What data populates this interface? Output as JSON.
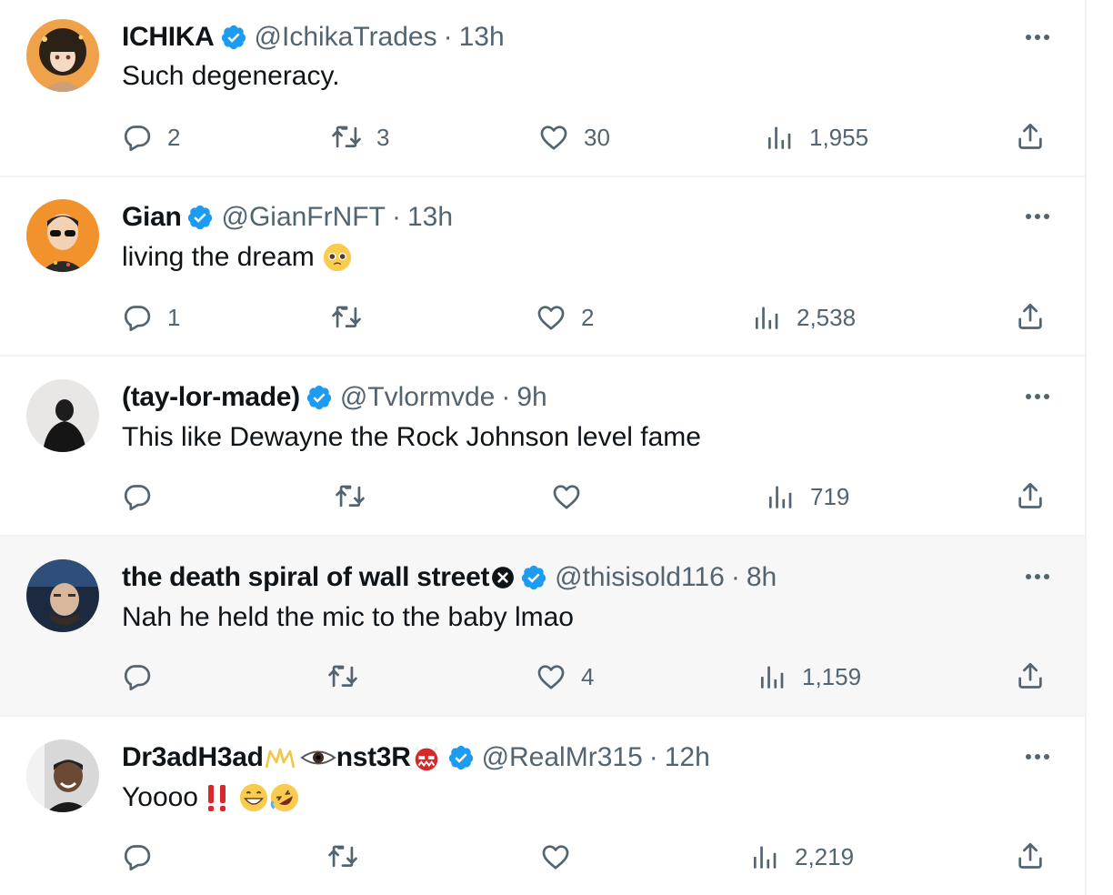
{
  "tweets": [
    {
      "name": "ICHIKA",
      "handle": "@IchikaTrades",
      "separator": "·",
      "time": "13h",
      "text": "Such degeneracy.",
      "reply_count": "2",
      "retweet_count": "3",
      "like_count": "30",
      "view_count": "1,955",
      "avatar_bg": "#f0a24a"
    },
    {
      "name": "Gian",
      "handle": "@GianFrNFT",
      "separator": "·",
      "time": "13h",
      "text": "living the dream",
      "text_emoji": "pleading-face-icon",
      "reply_count": "1",
      "retweet_count": "",
      "like_count": "2",
      "view_count": "2,538",
      "avatar_bg": "#f2922d"
    },
    {
      "name": "(tay-lor-made)",
      "handle": "@Tvlormvde",
      "separator": "·",
      "time": "9h",
      "text": "This like Dewayne the Rock Johnson level fame",
      "reply_count": "",
      "retweet_count": "",
      "like_count": "",
      "view_count": "719",
      "avatar_bg": "#e9e6e6"
    },
    {
      "name": "the death spiral of wall street",
      "handle": "@thisisold116",
      "separator": "·",
      "time": "8h",
      "text": "Nah he held the mic to the baby lmao",
      "reply_count": "",
      "retweet_count": "",
      "like_count": "4",
      "view_count": "1,159",
      "avatar_bg": "#1c2a3f",
      "highlighted": true
    },
    {
      "name": "Dr3adH3ad",
      "name_suffix": "nst3R",
      "handle": "@RealMr315",
      "separator": "·",
      "time": "12h",
      "text": "Yoooo",
      "reply_count": "",
      "retweet_count": "",
      "like_count": "",
      "view_count": "2,219",
      "avatar_bg": "#d8d8d8"
    }
  ],
  "colors": {
    "verified": "#1d9bf0",
    "text": "#0f1419",
    "secondary": "#536471",
    "divider": "#eff3f4",
    "highlight_bg": "#f7f7f7"
  }
}
